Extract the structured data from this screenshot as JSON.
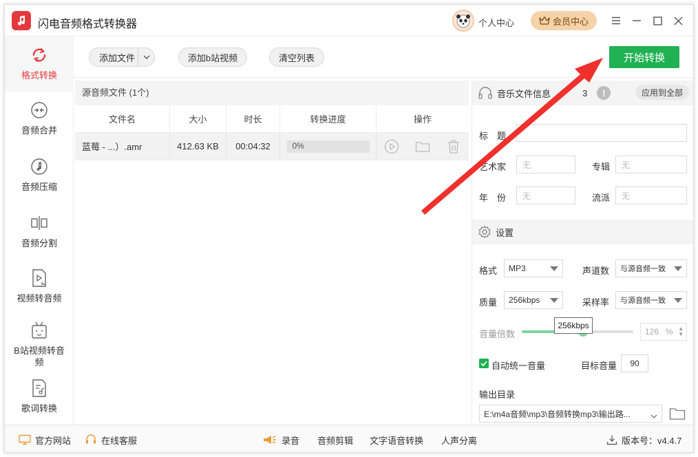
{
  "app": {
    "title": "闪电音频格式转换器",
    "personal_center": "个人中心",
    "vip_center": "会员中心"
  },
  "sidebar": {
    "items": [
      {
        "label": "格式转换"
      },
      {
        "label": "音频合并"
      },
      {
        "label": "音频压缩"
      },
      {
        "label": "音频分割"
      },
      {
        "label": "视频转音频"
      },
      {
        "label": "B站视频转音频"
      },
      {
        "label": "歌词转换"
      }
    ]
  },
  "toolbar": {
    "add_file": "添加文件",
    "add_bilibili": "添加b站视频",
    "clear_list": "清空列表",
    "start": "开始转换"
  },
  "filelist": {
    "header": "源音频文件 (1个)",
    "columns": [
      "文件名",
      "大小",
      "时长",
      "转换进度",
      "操作"
    ],
    "rows": [
      {
        "name": "蓝莓 - ...）.amr",
        "size": "412.63 KB",
        "duration": "00:04:32",
        "progress_text": "0%",
        "progress": 0
      }
    ]
  },
  "music_info": {
    "title": "音乐文件信息",
    "title_suffix": "3",
    "apply_all": "应用到全部",
    "title_label": "标　题",
    "title_value": "",
    "artist_label": "艺术家",
    "artist_value": "无",
    "album_label": "专辑",
    "album_value": "无",
    "year_label": "年　份",
    "year_value": "无",
    "genre_label": "流派",
    "genre_value": "无"
  },
  "settings": {
    "title": "设置",
    "format_label": "格式",
    "format_value": "MP3",
    "channels_label": "声道数",
    "channels_value": "与源音频一致",
    "quality_label": "质量",
    "quality_value": "256kbps",
    "samplerate_label": "采样率",
    "samplerate_value": "与源音频一致",
    "volume_label": "音量倍数",
    "volume_value": "126",
    "volume_unit": "%",
    "volume_level": 0.55,
    "auto_volume_label": "自动统一音量",
    "auto_volume_checked": true,
    "target_volume_label": "目标音量",
    "target_volume_value": "90",
    "output_label": "输出目录",
    "output_path": "E:\\m4a音频\\mp3\\音频转换mp3\\输出路..."
  },
  "tooltip": {
    "text": "256kbps"
  },
  "statusbar": {
    "website": "官方网站",
    "support": "在线客服",
    "record": "录音",
    "audio_edit": "音频剪辑",
    "tts": "文字语音转换",
    "vocal_sep": "人声分离",
    "version": "版本号：v4.4.7"
  },
  "colors": {
    "accent_red": "#e4393c",
    "start_green": "#1fb152",
    "vip_gold": "#f5d2a7",
    "arrow_red": "#f0302c"
  }
}
